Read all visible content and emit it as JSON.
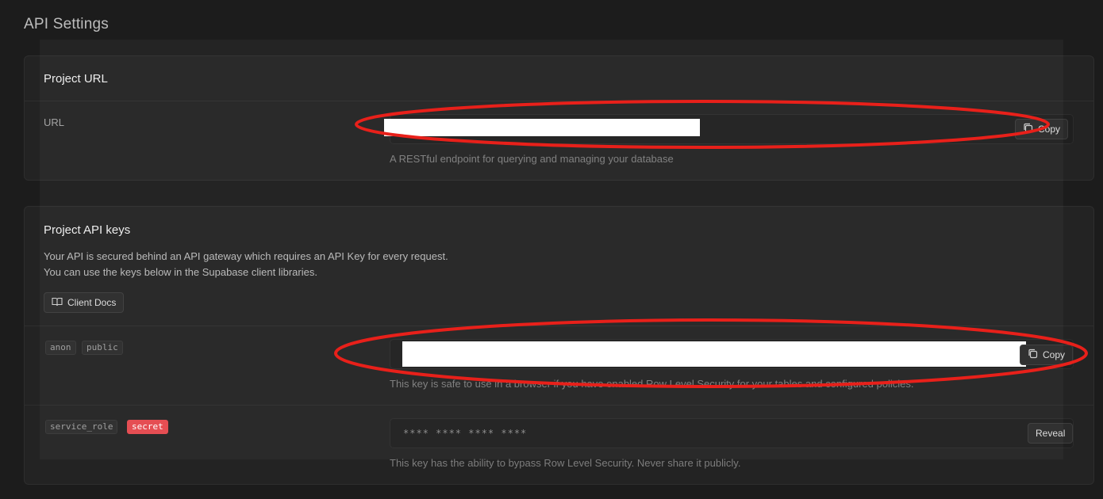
{
  "page": {
    "title": "API Settings"
  },
  "project_url": {
    "heading": "Project URL",
    "url_label": "URL",
    "url_value": "",
    "copy_label": "Copy",
    "helper": "A RESTful endpoint for querying and managing your database"
  },
  "api_keys": {
    "heading": "Project API keys",
    "description_line1": "Your API is secured behind an API gateway which requires an API Key for every request.",
    "description_line2": "You can use the keys below in the Supabase client libraries.",
    "docs_button_label": "Client Docs",
    "anon": {
      "tags": [
        "anon",
        "public"
      ],
      "value": "",
      "copy_label": "Copy",
      "helper": "This key is safe to use in a browser if you have enabled Row Level Security for your tables and configured policies."
    },
    "service_role": {
      "tags": [
        "service_role",
        "secret"
      ],
      "masked_value": "**** **** **** ****",
      "reveal_label": "Reveal",
      "helper": "This key has the ability to bypass Row Level Security. Never share it publicly."
    }
  },
  "colors": {
    "background": "#1c1c1c",
    "panel": "#232323",
    "secret_badge": "#e5484d",
    "annotation_red": "#e8201a"
  },
  "icons": {
    "copy": "copy-icon",
    "book": "book-icon"
  }
}
